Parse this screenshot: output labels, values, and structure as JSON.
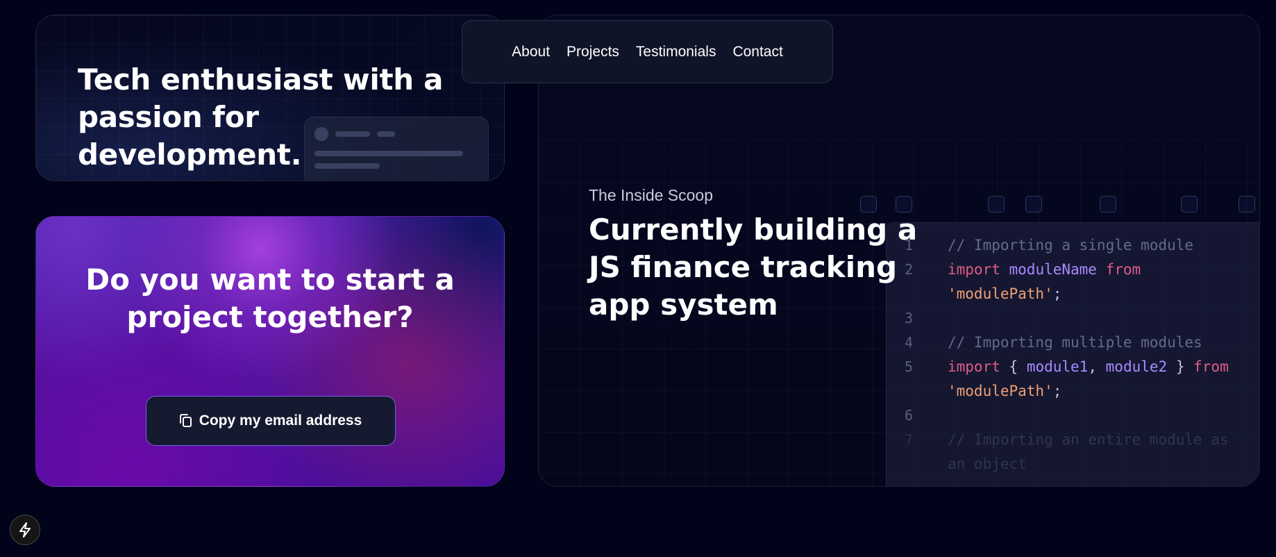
{
  "nav": {
    "items": [
      "About",
      "Projects",
      "Testimonials",
      "Contact"
    ]
  },
  "intro_card": {
    "headline": "Tech enthusiast with a passion for development."
  },
  "cta_card": {
    "headline": "Do you want to start a project together?",
    "copy_button_label": "Copy my email address",
    "copy_icon": "copy-icon"
  },
  "scoop_card": {
    "subtitle": "The Inside Scoop",
    "headline": "Currently building a JS finance tracking app system",
    "code_lines": [
      {
        "n": "1",
        "text": "// Importing a single module"
      },
      {
        "n": "2",
        "text": "import moduleName from"
      },
      {
        "n": "",
        "text": "'modulePath';"
      },
      {
        "n": "3",
        "text": ""
      },
      {
        "n": "4",
        "text": "// Importing multiple modules"
      },
      {
        "n": "5",
        "text": "import { module1, module2 } from"
      },
      {
        "n": "",
        "text": "'modulePath';"
      },
      {
        "n": "6",
        "text": ""
      },
      {
        "n": "7",
        "text": "// Importing an entire module as"
      },
      {
        "n": "",
        "text": "an object"
      }
    ]
  },
  "floating_button": {
    "icon": "lightning-bolt-icon"
  },
  "colors": {
    "background": "#000319",
    "cta_border": "#6e63e0",
    "keyword": "#e25b86",
    "identifier": "#a98bff",
    "string": "#f0a070"
  }
}
